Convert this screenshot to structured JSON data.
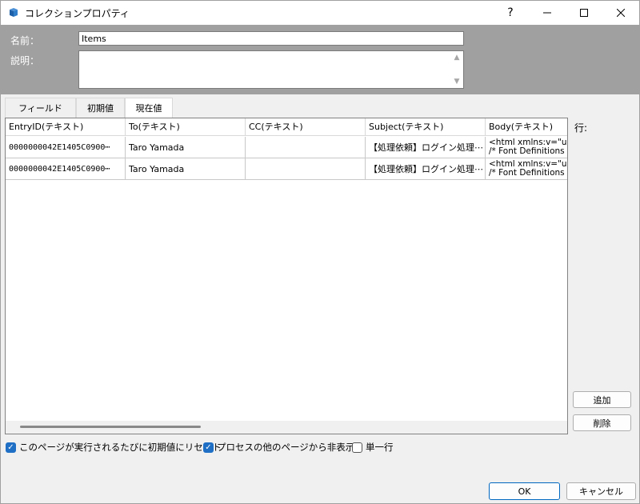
{
  "window": {
    "title": "コレクションプロパティ",
    "help_label": "?",
    "min_label": "—",
    "max_label": "☐",
    "close_label": "✕"
  },
  "form": {
    "name_label": "名前：",
    "name_value": "Items",
    "description_label": "説明：",
    "description_value": ""
  },
  "tabs": [
    {
      "label": "フィールド",
      "selected": false
    },
    {
      "label": "初期値",
      "selected": false
    },
    {
      "label": "現在値",
      "selected": true
    }
  ],
  "grid": {
    "columns": [
      "EntryID(テキスト)",
      "To(テキスト)",
      "CC(テキスト)",
      "Subject(テキスト)",
      "Body(テキスト)"
    ],
    "rows": [
      {
        "entry_id": "0000000042E1405C0900⋯",
        "to": "Taro Yamada",
        "cc": "",
        "subject": "【処理依頼】ログイン処理⋯",
        "body_line1": "<html xmlns:v=\"urr",
        "body_line2": "/* Font Definitions"
      },
      {
        "entry_id": "0000000042E1405C0900⋯",
        "to": "Taro Yamada",
        "cc": "",
        "subject": "【処理依頼】ログイン処理⋯",
        "body_line1": "<html xmlns:v=\"urr",
        "body_line2": "/* Font Definitions"
      }
    ]
  },
  "side": {
    "rows_label": "行:",
    "add_label": "追加",
    "delete_label": "削除"
  },
  "options": {
    "reset_label": "このページが実行されるたびに初期値にリセット",
    "reset_checked": true,
    "hide_label": "プロセスの他のページから非表示",
    "hide_checked": true,
    "single_label": "単一行",
    "single_checked": false
  },
  "footer": {
    "ok_label": "OK",
    "cancel_label": "キャンセル"
  },
  "colors": {
    "header_gray": "#a0a0a0",
    "accent": "#1f6fc5"
  }
}
